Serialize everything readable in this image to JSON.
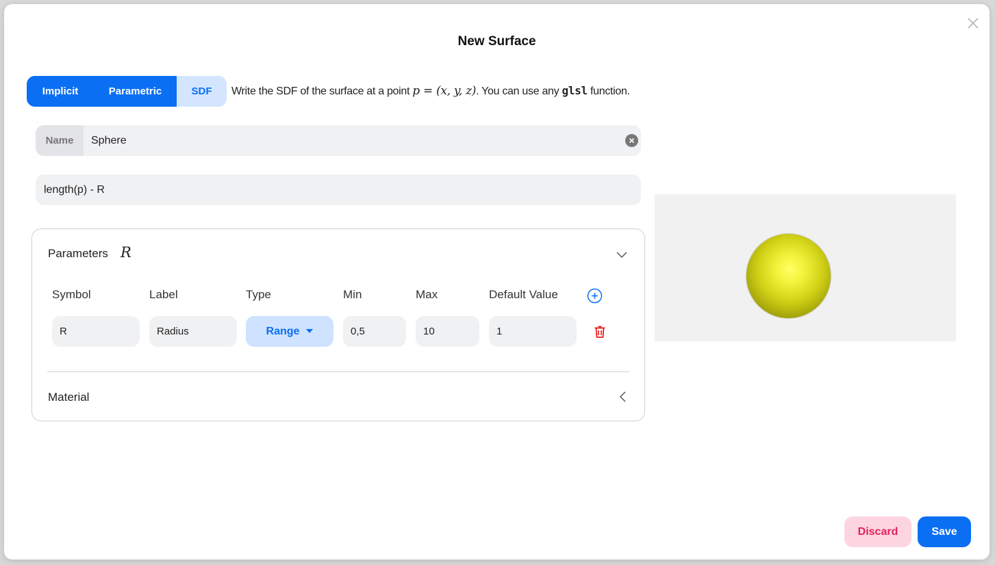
{
  "modal": {
    "title": "New Surface"
  },
  "tabs": [
    {
      "label": "Implicit",
      "active": true
    },
    {
      "label": "Parametric",
      "active": true
    },
    {
      "label": "SDF",
      "active": false
    }
  ],
  "hint": {
    "prefix": "Write the SDF of the surface at a point ",
    "math": "p = (x, y, z)",
    "middle": ". You can use any ",
    "code": "glsl",
    "suffix": " function."
  },
  "name_field": {
    "label": "Name",
    "value": "Sphere"
  },
  "expression": {
    "value": "length(p) - R"
  },
  "parameters": {
    "header": "Parameters",
    "symbols_summary": "R",
    "columns": [
      "Symbol",
      "Label",
      "Type",
      "Min",
      "Max",
      "Default Value"
    ],
    "rows": [
      {
        "symbol": "R",
        "label": "Radius",
        "type": "Range",
        "min": "0,5",
        "max": "10",
        "default": "1"
      }
    ]
  },
  "material": {
    "header": "Material"
  },
  "preview": {
    "sphere_color": "#f2f23a",
    "background": "#f1f1f1"
  },
  "footer": {
    "discard_label": "Discard",
    "save_label": "Save"
  },
  "colors": {
    "accent": "#0a6ff3",
    "danger": "#e3215b"
  }
}
